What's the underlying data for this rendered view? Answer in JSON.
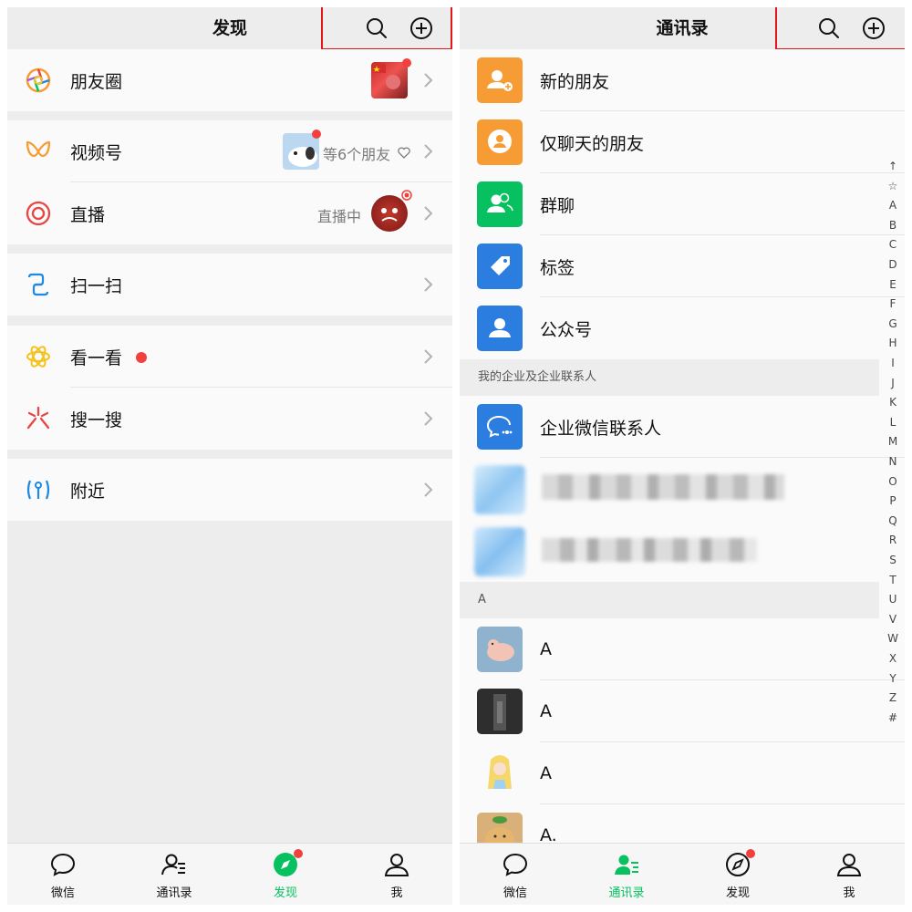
{
  "left": {
    "header_title": "发现",
    "items": {
      "moments": {
        "label": "朋友圈"
      },
      "channels": {
        "label": "视频号",
        "sub": "等6个朋友"
      },
      "live": {
        "label": "直播",
        "sub": "直播中"
      },
      "scan": {
        "label": "扫一扫"
      },
      "topstories": {
        "label": "看一看"
      },
      "search": {
        "label": "搜一搜"
      },
      "nearby": {
        "label": "附近"
      }
    },
    "tabbar": {
      "chats": "微信",
      "contacts": "通讯录",
      "discover": "发现",
      "me": "我",
      "active": "discover"
    }
  },
  "right": {
    "header_title": "通讯录",
    "items": {
      "new_friends": {
        "label": "新的朋友"
      },
      "chat_only": {
        "label": "仅聊天的朋友"
      },
      "group_chats": {
        "label": "群聊"
      },
      "tags": {
        "label": "标签"
      },
      "official_accounts": {
        "label": "公众号"
      }
    },
    "sections": {
      "enterprise": "我的企业及企业联系人",
      "a": "A"
    },
    "enterprise_contacts": {
      "label": "企业微信联系人"
    },
    "contacts": [
      "A",
      "A",
      "A",
      "A."
    ],
    "index": [
      "↑",
      "☆",
      "A",
      "B",
      "C",
      "D",
      "E",
      "F",
      "G",
      "H",
      "I",
      "J",
      "K",
      "L",
      "M",
      "N",
      "O",
      "P",
      "Q",
      "R",
      "S",
      "T",
      "U",
      "V",
      "W",
      "X",
      "Y",
      "Z",
      "#"
    ],
    "tabbar": {
      "chats": "微信",
      "contacts": "通讯录",
      "discover": "发现",
      "me": "我",
      "active": "contacts"
    }
  },
  "colors": {
    "accent": "#07c160",
    "badge": "#f0413e",
    "highlight": "#e0161b",
    "orange": "#f79c34",
    "blue": "#2b7ee0",
    "green": "#07c160"
  }
}
